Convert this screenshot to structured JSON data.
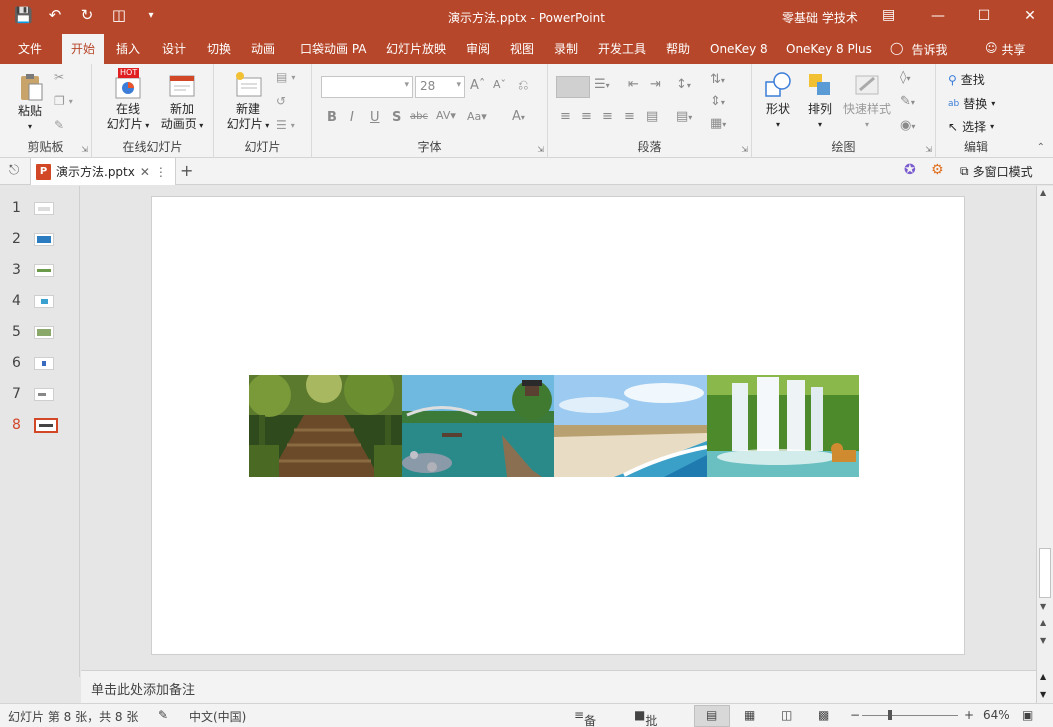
{
  "window": {
    "title": "演示方法.pptx  -  PowerPoint",
    "user": "零基础 学技术",
    "colors": {
      "accent": "#b7472a",
      "selected": "#d24726"
    }
  },
  "qat": {
    "icons": [
      "save-icon",
      "undo-icon",
      "redo-icon",
      "present-icon",
      "customize-icon"
    ]
  },
  "tabs": [
    "文件",
    "开始",
    "插入",
    "设计",
    "切换",
    "动画",
    "口袋动画 PA",
    "幻灯片放映",
    "审阅",
    "视图",
    "录制",
    "开发工具",
    "帮助",
    "OneKey 8",
    "OneKey 8 Plus"
  ],
  "active_tab": "开始",
  "tellme": "告诉我",
  "share": "共享",
  "ribbon": {
    "clipboard": {
      "label": "剪贴板",
      "paste": "粘贴"
    },
    "online": {
      "label": "在线幻灯片",
      "hot": "HOT",
      "btn1_line1": "在线",
      "btn1_line2": "幻灯片",
      "btn2_line1": "新加",
      "btn2_line2": "动画页"
    },
    "slides": {
      "label": "幻灯片",
      "new_line1": "新建",
      "new_line2": "幻灯片"
    },
    "font": {
      "label": "字体",
      "font_name": "",
      "font_size": "28"
    },
    "paragraph": {
      "label": "段落"
    },
    "drawing": {
      "label": "绘图",
      "shapes": "形状",
      "arrange": "排列",
      "quick_styles": "快速样式"
    },
    "editing": {
      "label": "编辑",
      "find": "查找",
      "replace": "替换",
      "select": "选择"
    }
  },
  "docbar": {
    "file_tab": "演示方法.pptx",
    "multiwindow": "多窗口模式"
  },
  "thumbnails": [
    "1",
    "2",
    "3",
    "4",
    "5",
    "6",
    "7",
    "8"
  ],
  "selected_slide": "8",
  "notes_placeholder": "单击此处添加备注",
  "status": {
    "slide_info": "幻灯片 第 8 张，共 8 张",
    "language": "中文(中国)",
    "notes": "备注",
    "comments": "批注",
    "zoom": "64%"
  }
}
